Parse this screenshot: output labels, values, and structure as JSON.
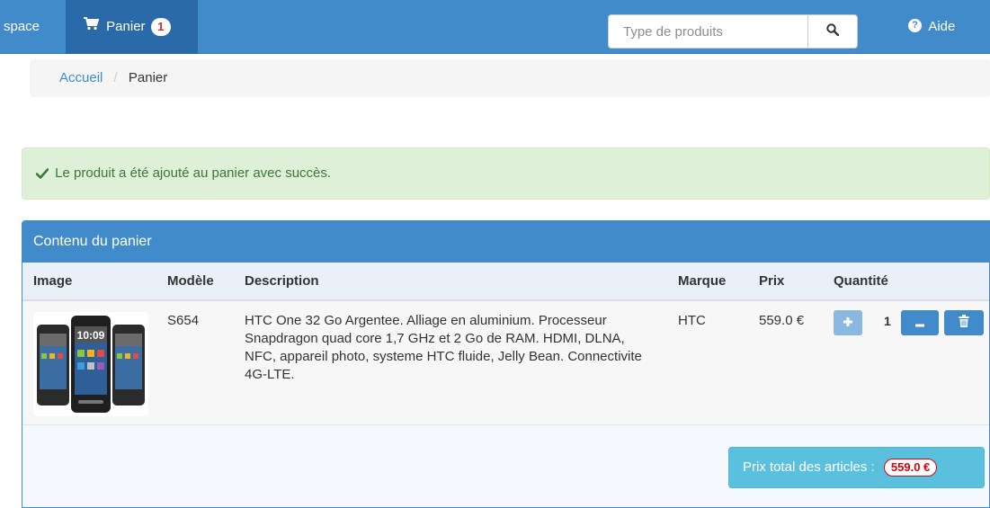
{
  "navbar": {
    "espace_label": "space",
    "panier_label": "Panier",
    "panier_count": "1",
    "search": {
      "placeholder": "Type de produits"
    },
    "aide_label": "Aide"
  },
  "breadcrumb": {
    "home": "Accueil",
    "separator": "/",
    "current": "Panier"
  },
  "alert": {
    "message": "Le produit a été ajouté au panier avec succès."
  },
  "cart": {
    "heading": "Contenu du panier",
    "columns": {
      "image": "Image",
      "model": "Modèle",
      "description": "Description",
      "brand": "Marque",
      "price": "Prix",
      "quantity": "Quantité"
    },
    "items": [
      {
        "model": "S654",
        "description": "HTC One 32 Go Argentee. Alliage en aluminium. Processeur Snapdragon quad core 1,7 GHz et 2 Go de RAM. HDMI, DLNA, NFC, appareil photo, systeme HTC fluide, Jelly Bean. Connectivite 4G-LTE.",
        "brand": "HTC",
        "price": "559.0 €",
        "quantity": "1",
        "phone_clock": "10:09"
      }
    ],
    "total_label": "Prix total des articles :",
    "total_value": "559.0 €"
  },
  "colors": {
    "primary": "#428bca",
    "success_bg": "#dff0d8",
    "success_text": "#3c763d",
    "info": "#5bc0de",
    "danger": "#d9000d"
  }
}
